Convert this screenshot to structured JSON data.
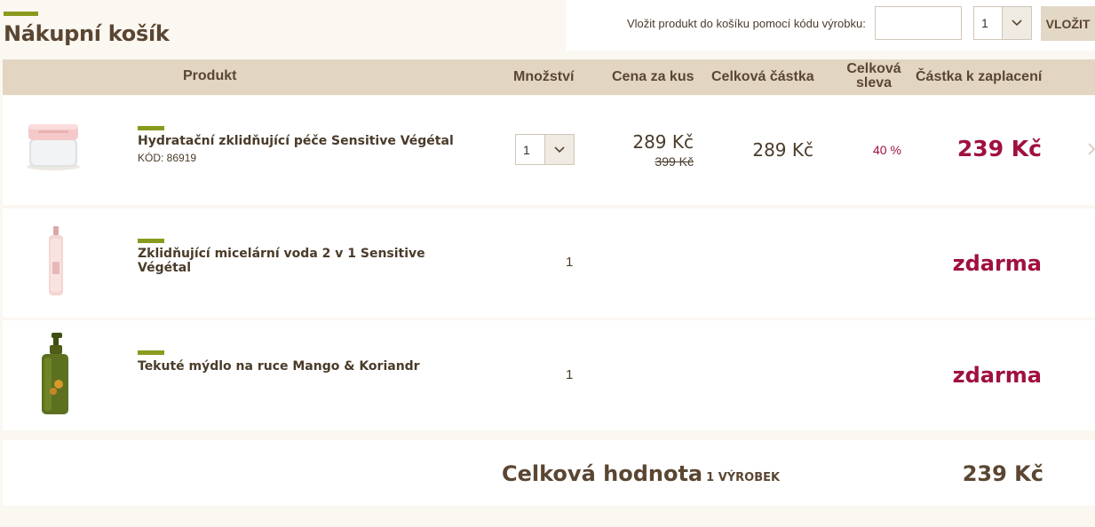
{
  "header": {
    "title": "Nákupní košík",
    "code_label": "Vložit produkt do košíku pomocí kódu výrobku:",
    "code_input_value": "",
    "code_qty": "1",
    "add_button": "VLOŽIT"
  },
  "table": {
    "columns": {
      "product": "Produkt",
      "quantity": "Množství",
      "unit_price": "Cena za kus",
      "total": "Celková částka",
      "discount": "Celková sleva",
      "to_pay": "Částka k zaplacení"
    },
    "rows": [
      {
        "name": "Hydratační zklidňující péče Sensitive Végétal",
        "code": "KÓD: 86919",
        "quantity": "1",
        "unit_price": "289 Kč",
        "old_price": "399 Kč",
        "total": "289 Kč",
        "discount": "40 %",
        "to_pay": "239 Kč"
      },
      {
        "name": "Zklidňující micelární voda 2 v 1 Sensitive Végétal",
        "quantity": "1",
        "to_pay": "zdarma"
      },
      {
        "name": "Tekuté mýdlo na ruce Mango & Koriandr",
        "quantity": "1",
        "to_pay": "zdarma"
      }
    ]
  },
  "summary": {
    "label": "Celková hodnota",
    "count": "1 VÝROBEK",
    "total": "239 Kč"
  },
  "colors": {
    "accent_green": "#8a9a1e",
    "price_red": "#a0103e",
    "header_beige": "#e2d6c3"
  }
}
